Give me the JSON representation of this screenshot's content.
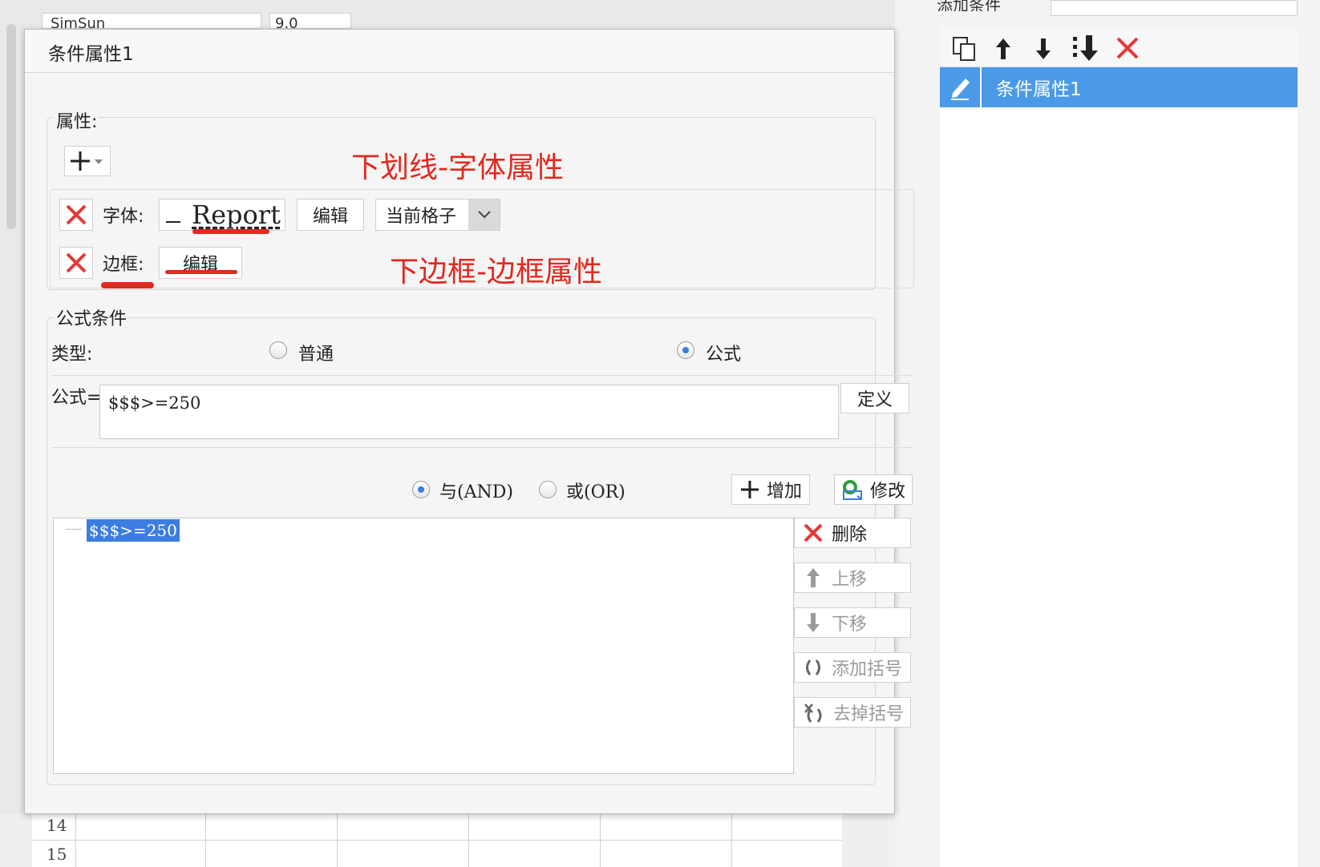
{
  "background": {
    "toolbar_font_value": "SimSun",
    "toolbar_size_value": "9.0",
    "right_panel_title": "添加条件",
    "right_panel_item": "条件属性1",
    "row_numbers": [
      "14",
      "15"
    ]
  },
  "dialog": {
    "title": "条件属性1",
    "properties_group_label": "属性:",
    "font_label": "字体:",
    "font_preview_text": "Report",
    "font_edit_button": "编辑",
    "apply_scope_value": "当前格子",
    "border_label": "边框:",
    "border_edit_button": "编辑",
    "annotation_font": "下划线-字体属性",
    "annotation_border": "下边框-边框属性",
    "formula_group_label": "公式条件",
    "type_label": "类型:",
    "type_option_normal": "普通",
    "type_option_formula": "公式",
    "formula_label": "公式=",
    "formula_value": "$$$>=250",
    "define_button": "定义",
    "and_option": "与(AND)",
    "or_option": "或(OR)",
    "add_button": "增加",
    "modify_button": "修改",
    "condition_tree": [
      "$$$>=250"
    ],
    "delete_button": "删除",
    "move_up_button": "上移",
    "move_down_button": "下移",
    "add_bracket_button": "添加括号",
    "remove_bracket_button": "去掉括号"
  },
  "colors": {
    "annotation_red": "#e3281f",
    "selection_blue": "#4a9ae8",
    "delete_red": "#e53935"
  }
}
